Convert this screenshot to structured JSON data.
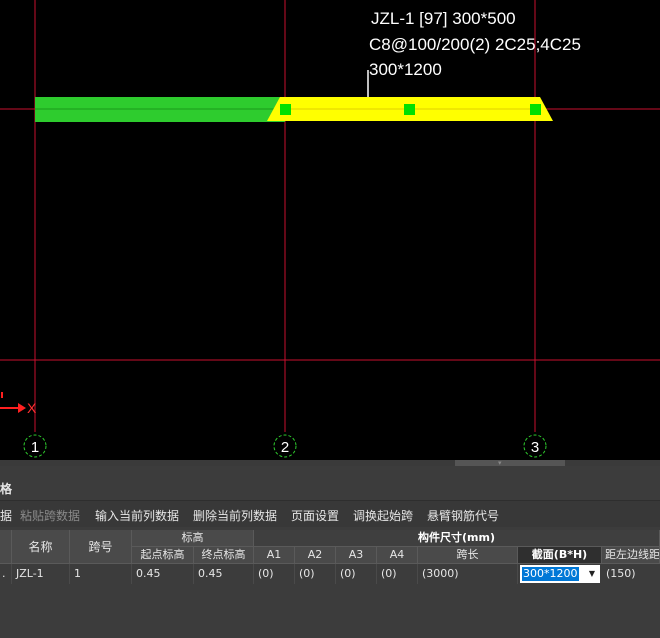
{
  "annotation": {
    "line1": "JZL-1 [97] 300*500",
    "line2": "C8@100/200(2) 2C25;4C25",
    "line3": "300*1200"
  },
  "axes": [
    "1",
    "2",
    "3"
  ],
  "ucs_x_label": "X",
  "colors": {
    "axis_line": "#c8102e",
    "beam_green": "#2ecc2e",
    "beam_yellow": "#ffff00",
    "grip": "#00e000",
    "background": "#000000"
  },
  "panel": {
    "title": "格",
    "toolbar": [
      {
        "label": "据",
        "enabled": true
      },
      {
        "label": "粘贴跨数据",
        "enabled": false
      },
      {
        "label": "输入当前列数据",
        "enabled": true
      },
      {
        "label": "删除当前列数据",
        "enabled": true
      },
      {
        "label": "页面设置",
        "enabled": true
      },
      {
        "label": "调换起始跨",
        "enabled": true
      },
      {
        "label": "悬臂钢筋代号",
        "enabled": true
      }
    ],
    "headers": {
      "name": "名称",
      "span_no": "跨号",
      "elevation_group": "标高",
      "start_elev": "起点标高",
      "end_elev": "终点标高",
      "dim_group": "构件尺寸(mm)",
      "a1": "A1",
      "a2": "A2",
      "a3": "A3",
      "a4": "A4",
      "span_len": "跨长",
      "section": "截面(B*H)",
      "edge_dist": "距左边线距"
    },
    "row": {
      "index": ".",
      "name": "JZL-1",
      "span_no": "1",
      "start_elev": "0.45",
      "end_elev": "0.45",
      "a1": "(0)",
      "a2": "(0)",
      "a3": "(0)",
      "a4": "(0)",
      "span_len": "(3000)",
      "section": "300*1200",
      "edge_dist": "(150)"
    }
  }
}
